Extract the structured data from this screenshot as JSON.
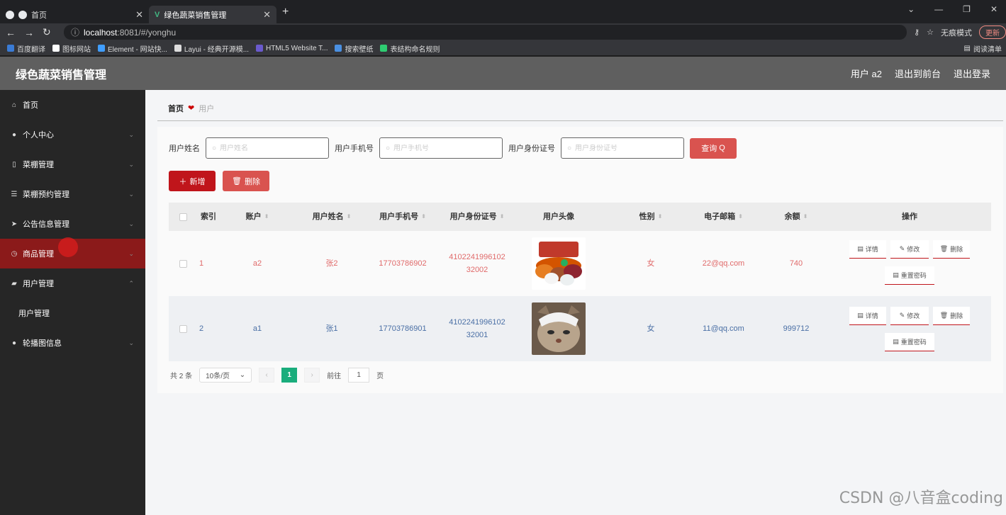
{
  "browser": {
    "tabs": [
      {
        "label": "首页"
      },
      {
        "label": "绿色蔬菜销售管理"
      }
    ],
    "url_host": "localhost",
    "url_rest": ":8081/#/yonghu",
    "incognito_label": "无痕模式",
    "update_label": "更新",
    "bookmarks": [
      {
        "label": "百度翻译",
        "color": "#3a7bd5"
      },
      {
        "label": "图标网站",
        "color": "#ffffff"
      },
      {
        "label": "Element - 网站快...",
        "color": "#409eff"
      },
      {
        "label": "Layui - 经典开源模...",
        "color": "#dddddd"
      },
      {
        "label": "HTML5 Website T...",
        "color": "#6a5acd"
      },
      {
        "label": "搜索壁纸",
        "color": "#4a90e2"
      },
      {
        "label": "表结构命名规则",
        "color": "#2ecc71"
      }
    ],
    "reading_list": "阅读清单"
  },
  "header": {
    "title": "绿色蔬菜销售管理",
    "user_label": "用户 a2",
    "back_label": "退出到前台",
    "logout_label": "退出登录"
  },
  "sidebar": {
    "items": [
      {
        "label": "首页",
        "icon": "home-icon"
      },
      {
        "label": "个人中心",
        "icon": "person-icon"
      },
      {
        "label": "菜棚管理",
        "icon": "mobile-icon"
      },
      {
        "label": "菜棚预约管理",
        "icon": "sliders-icon"
      },
      {
        "label": "公告信息管理",
        "icon": "send-icon"
      },
      {
        "label": "商品管理",
        "icon": "clock-icon"
      },
      {
        "label": "用户管理",
        "icon": "folder-icon"
      },
      {
        "label": "用户管理",
        "icon": "none"
      },
      {
        "label": "轮播图信息",
        "icon": "person-icon"
      }
    ]
  },
  "breadcrumb": {
    "home": "首页",
    "current": "用户"
  },
  "search": {
    "name_label": "用户姓名",
    "name_placeholder": "用户姓名",
    "phone_label": "用户手机号",
    "phone_placeholder": "用户手机号",
    "id_label": "用户身份证号",
    "id_placeholder": "用户身份证号",
    "query_label": "查询"
  },
  "actions": {
    "add_label": "新增",
    "delete_label": "删除"
  },
  "table": {
    "headers": {
      "index": "索引",
      "account": "账户",
      "name": "用户姓名",
      "phone": "用户手机号",
      "idcard": "用户身份证号",
      "avatar": "用户头像",
      "gender": "性别",
      "email": "电子邮箱",
      "balance": "余额",
      "ops": "操作"
    },
    "rows": [
      {
        "index": "1",
        "account": "a2",
        "name": "张2",
        "phone": "17703786902",
        "idcard_1": "4102241996102",
        "idcard_2": "32002",
        "gender": "女",
        "email": "22@qq.com",
        "balance": "740"
      },
      {
        "index": "2",
        "account": "a1",
        "name": "张1",
        "phone": "17703786901",
        "idcard_1": "4102241996102",
        "idcard_2": "32001",
        "gender": "女",
        "email": "11@qq.com",
        "balance": "999712"
      }
    ],
    "op_labels": {
      "detail": "详情",
      "edit": "修改",
      "delete": "删除",
      "reset": "重置密码"
    }
  },
  "pager": {
    "total": "共 2 条",
    "size": "10条/页",
    "current": "1",
    "goto_label": "前往",
    "goto_value": "1",
    "page_suffix": "页"
  },
  "watermark": "CSDN @八音盒coding"
}
